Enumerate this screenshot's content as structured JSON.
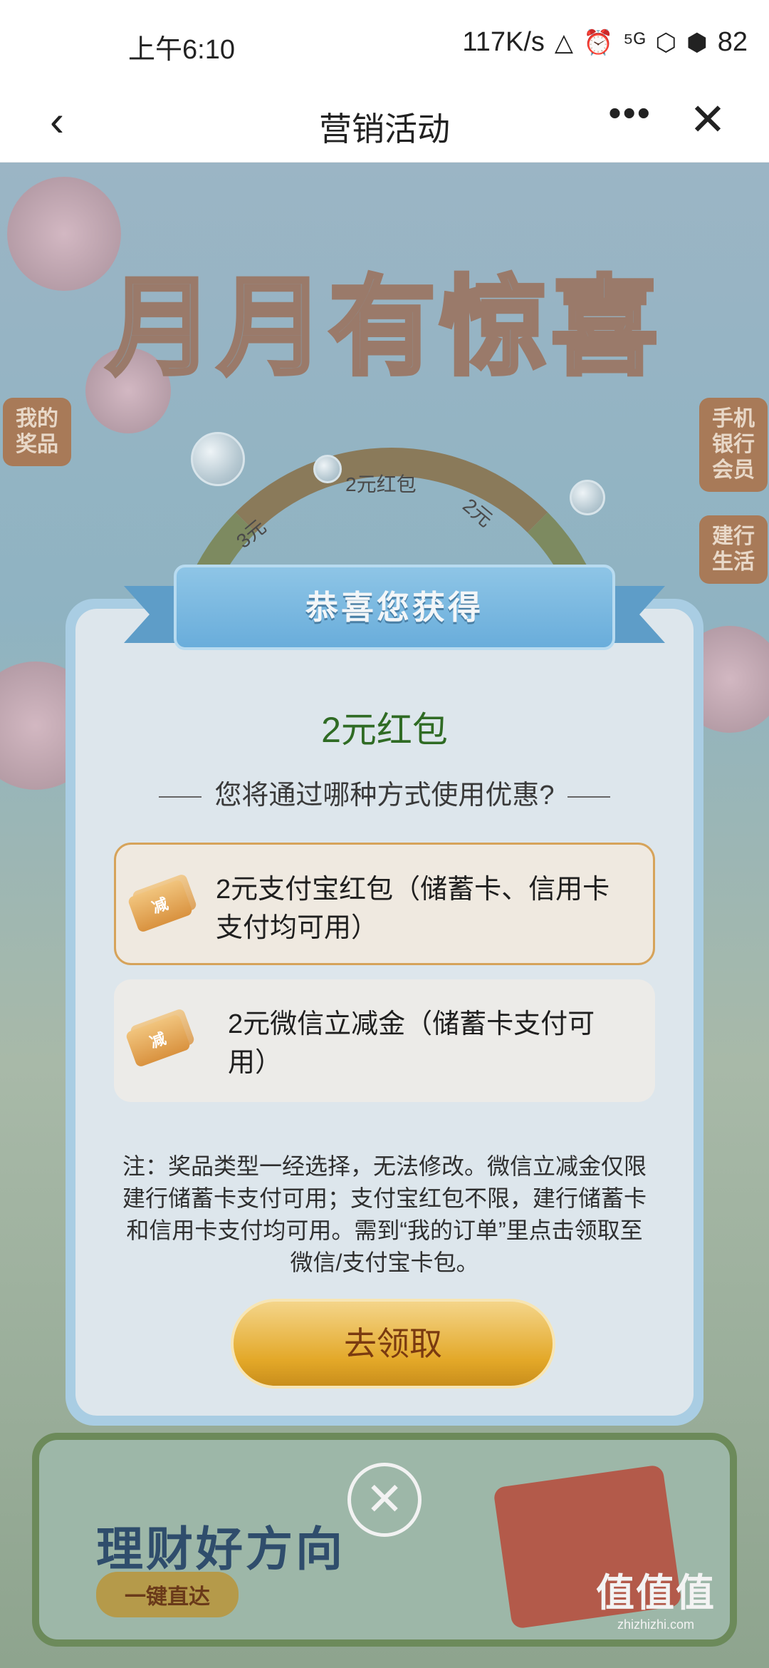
{
  "status_bar": {
    "time": "上午6:10",
    "speed": "117K/s",
    "battery": "82"
  },
  "nav": {
    "title": "营销活动"
  },
  "background": {
    "title": "月月有惊喜",
    "left_tab": "我的奖品",
    "right_tab_1": "手机银行会员",
    "right_tab_2": "建行生活",
    "wheel_label_top": "2元红包",
    "wheel_label_left": "3元",
    "wheel_label_right": "2元",
    "banner_title": "理财好方向",
    "banner_button": "一键直达"
  },
  "modal": {
    "ribbon_title": "恭喜您获得",
    "prize_name": "2元红包",
    "question": "您将通过哪种方式使用优惠?",
    "options": [
      {
        "icon": "coupon-ticket-icon",
        "icon_text": "减",
        "label": "2元支付宝红包（储蓄卡、信用卡支付均可用）",
        "selected": true
      },
      {
        "icon": "coupon-ticket-icon",
        "icon_text": "减",
        "label": "2元微信立减金（储蓄卡支付可用）",
        "selected": false
      }
    ],
    "note": "注：奖品类型一经选择，无法修改。微信立减金仅限建行储蓄卡支付可用；支付宝红包不限，建行储蓄卡和信用卡支付均可用。需到“我的订单”里点击领取至微信/支付宝卡包。",
    "claim_button": "去领取"
  },
  "watermark": {
    "big": "值值值",
    "small": "zhizhizhi.com"
  },
  "colors": {
    "prize_green": "#2f6b24",
    "selected_border": "#d6a35a",
    "button_gold": "#e3a828",
    "ribbon_blue": "#69addb"
  }
}
